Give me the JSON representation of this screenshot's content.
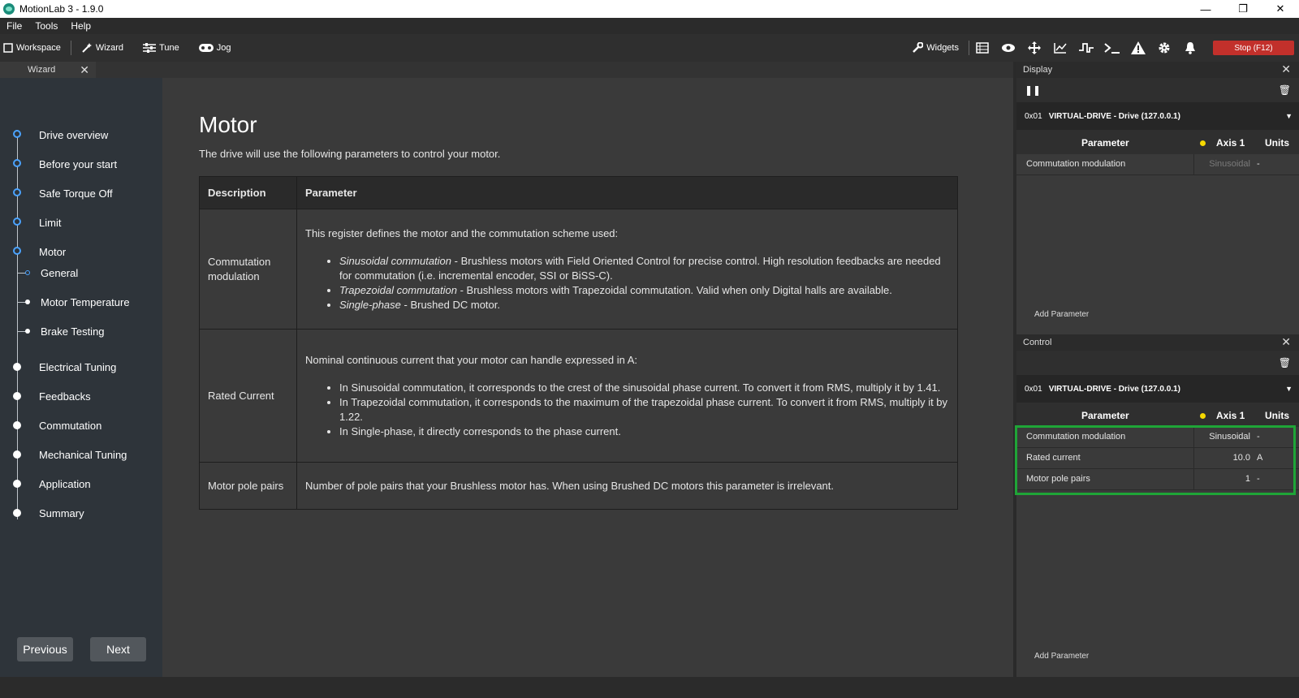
{
  "window": {
    "title": "MotionLab 3 - 1.9.0",
    "minimize": "—",
    "maximize": "❐",
    "close": "✕"
  },
  "menu": [
    "File",
    "Tools",
    "Help"
  ],
  "toolbar": {
    "workspace": "Workspace",
    "wizard": "Wizard",
    "tune": "Tune",
    "jog": "Jog",
    "widgets": "Widgets",
    "stop": "Stop (F12)"
  },
  "tab": {
    "label": "Wizard",
    "close": "✕"
  },
  "steps": [
    "Drive overview",
    "Before your start",
    "Safe Torque Off",
    "Limit",
    "Motor",
    "General",
    "Motor Temperature",
    "Brake Testing",
    "Electrical Tuning",
    "Feedbacks",
    "Commutation",
    "Mechanical Tuning",
    "Application",
    "Summary"
  ],
  "nav": {
    "previous": "Previous",
    "next": "Next"
  },
  "page": {
    "title": "Motor",
    "subtitle": "The drive will use the following parameters to control your motor.",
    "table": {
      "headers": [
        "Description",
        "Parameter"
      ],
      "rows": [
        {
          "desc": "Commutation modulation",
          "intro": "This register defines the motor and the commutation scheme used:",
          "bullets": [
            {
              "em": "Sinusoidal commutation",
              "text": " - Brushless motors with Field Oriented Control for precise control. High resolution feedbacks are needed for commutation (i.e. incremental encoder, SSI or BiSS-C)."
            },
            {
              "em": "Trapezoidal commutation",
              "text": " - Brushless motors with Trapezoidal commutation. Valid when only Digital halls are available."
            },
            {
              "em": "Single-phase",
              "text": " - Brushed DC motor."
            }
          ]
        },
        {
          "desc": "Rated Current",
          "intro": "Nominal continuous current that your motor can handle expressed in A:",
          "bullets": [
            {
              "em": "",
              "text": "In Sinusoidal commutation, it corresponds to the crest of the sinusoidal phase current. To convert it from RMS, multiply it by 1.41."
            },
            {
              "em": "",
              "text": "In Trapezoidal commutation, it corresponds to the maximum of the trapezoidal phase current. To convert it from RMS, multiply it by 1.22."
            },
            {
              "em": "",
              "text": "In Single-phase, it directly corresponds to the phase current."
            }
          ]
        },
        {
          "desc": "Motor pole pairs",
          "intro": "Number of pole pairs that your Brushless motor has. When using Brushed DC motors this parameter is irrelevant.",
          "bullets": []
        }
      ]
    }
  },
  "display_panel": {
    "title": "Display",
    "drive_addr": "0x01",
    "drive_name": "VIRTUAL-DRIVE - Drive (127.0.0.1)",
    "cols": {
      "param": "Parameter",
      "axis": "Axis 1",
      "units": "Units"
    },
    "rows": [
      {
        "name": "Commutation modulation",
        "value": "Sinusoidal",
        "unit": "-"
      }
    ],
    "add": "Add Parameter"
  },
  "control_panel": {
    "title": "Control",
    "drive_addr": "0x01",
    "drive_name": "VIRTUAL-DRIVE - Drive (127.0.0.1)",
    "cols": {
      "param": "Parameter",
      "axis": "Axis 1",
      "units": "Units"
    },
    "rows": [
      {
        "name": "Commutation modulation",
        "value": "Sinusoidal",
        "unit": "-"
      },
      {
        "name": "Rated current",
        "value": "10.0",
        "unit": "A"
      },
      {
        "name": "Motor pole pairs",
        "value": "1",
        "unit": "-"
      }
    ],
    "add": "Add Parameter"
  },
  "colors": {
    "accent": "#4ba3ff",
    "stop": "#c2302b",
    "highlight": "#1fa537",
    "status_dot": "#f5d800"
  }
}
